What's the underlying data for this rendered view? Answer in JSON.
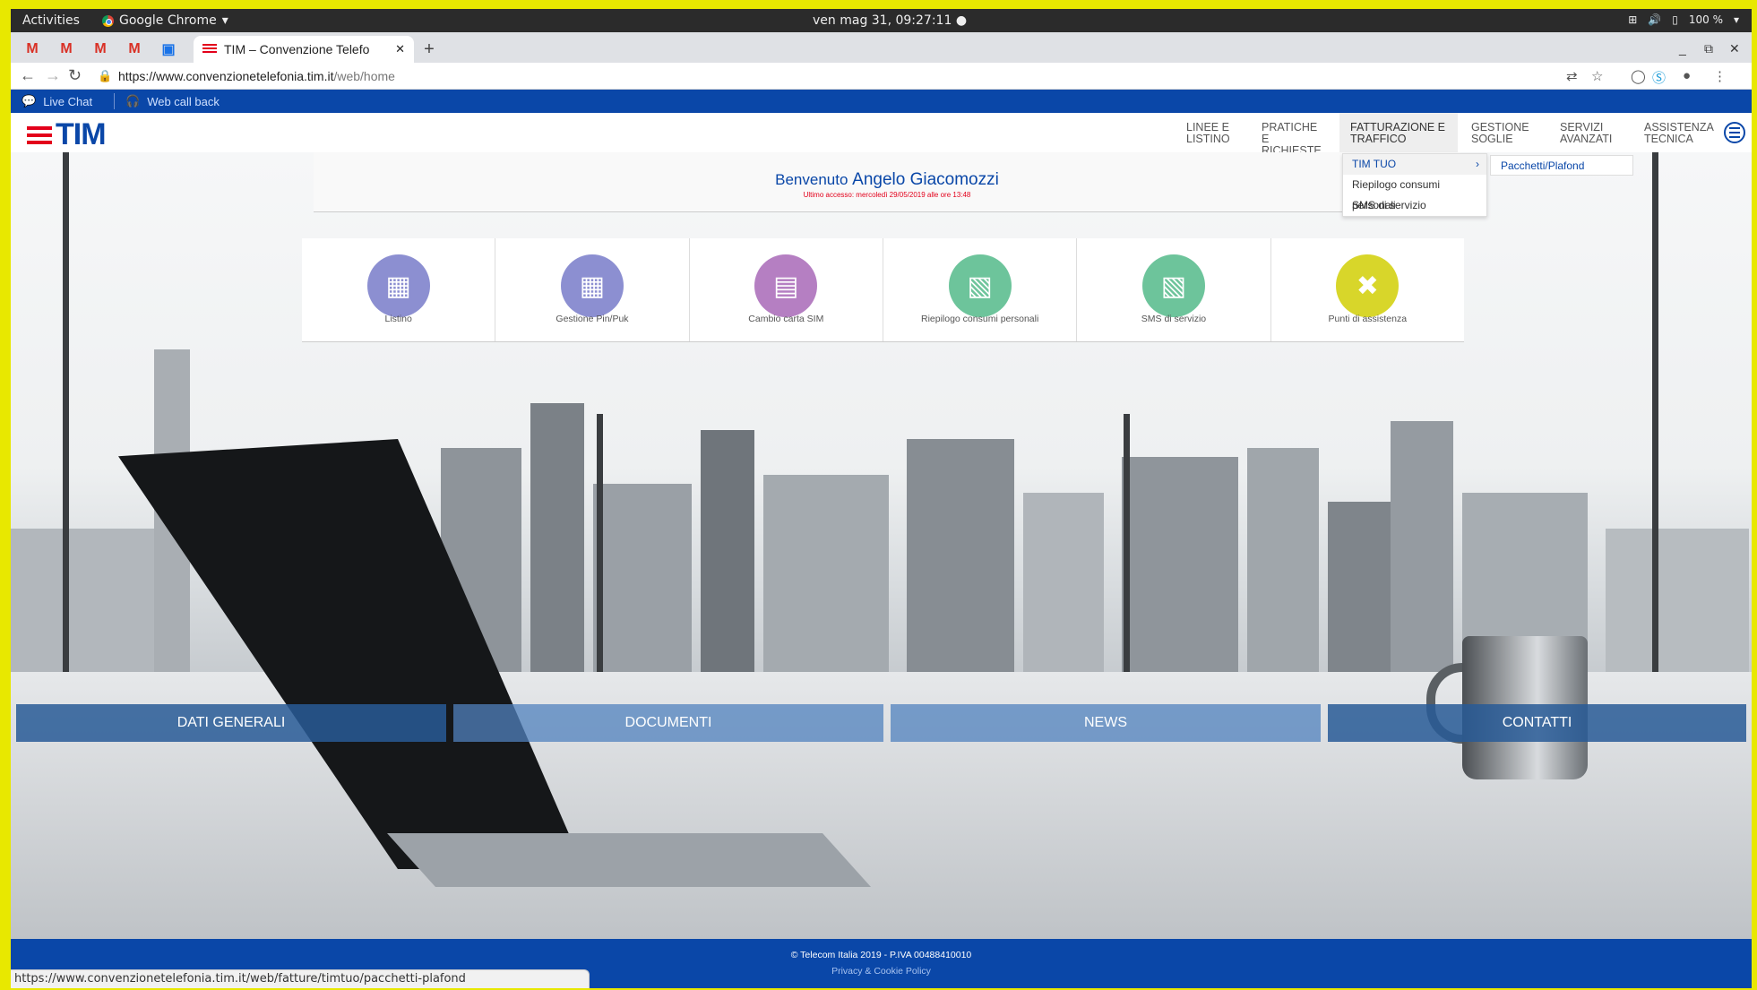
{
  "os": {
    "activities": "Activities",
    "app_name": "Google Chrome",
    "clock": "ven mag 31, 09:27:11",
    "battery": "100 %"
  },
  "browser": {
    "active_tab_title": "TIM – Convenzione Telefo",
    "url_host": "https://www.convenzionetelefonia.tim.it",
    "url_path": "/web/home",
    "status_url": "https://www.convenzionetelefonia.tim.it/web/fatture/timtuo/pacchetti-plafond"
  },
  "utility": {
    "live_chat": "Live Chat",
    "web_call_back": "Web call back"
  },
  "header": {
    "logo_text": "TIM",
    "nav": [
      {
        "label": "LINEE E LISTINO"
      },
      {
        "label": "PRATICHE E RICHIESTE"
      },
      {
        "label": "FATTURAZIONE E TRAFFICO"
      },
      {
        "label": "GESTIONE SOGLIE"
      },
      {
        "label": "SERVIZI AVANZATI"
      },
      {
        "label": "ASSISTENZA TECNICA"
      }
    ]
  },
  "dropdown": {
    "items": [
      {
        "label": "TIM TUO"
      },
      {
        "label": "Riepilogo consumi personali"
      },
      {
        "label": "SMS di servizio"
      }
    ],
    "submenu": "Pacchetti/Plafond"
  },
  "welcome": {
    "greeting": "Benvenuto",
    "name": "Angelo Giacomozzi",
    "last_access": "Ultimo accesso: mercoledì 29/05/2019 alle ore 13:48"
  },
  "tiles": [
    {
      "label": "Listino",
      "color": "#8c8fd1"
    },
    {
      "label": "Gestione Pin/Puk",
      "color": "#8c8fd1"
    },
    {
      "label": "Cambio carta SIM",
      "color": "#b57fc2"
    },
    {
      "label": "Riepilogo consumi personali",
      "color": "#6dc49b"
    },
    {
      "label": "SMS di servizio",
      "color": "#6dc49b"
    },
    {
      "label": "Punti di assistenza",
      "color": "#d8d62a"
    }
  ],
  "bottom_nav": [
    {
      "label": "DATI GENERALI"
    },
    {
      "label": "DOCUMENTI"
    },
    {
      "label": "NEWS"
    },
    {
      "label": "CONTATTI"
    }
  ],
  "footer": {
    "copyright": "© Telecom Italia 2019 - P.IVA 00488410010",
    "privacy": "Privacy & Cookie Policy"
  },
  "colors": {
    "tim_blue": "#0a47a8",
    "tim_red": "#e3001b"
  }
}
